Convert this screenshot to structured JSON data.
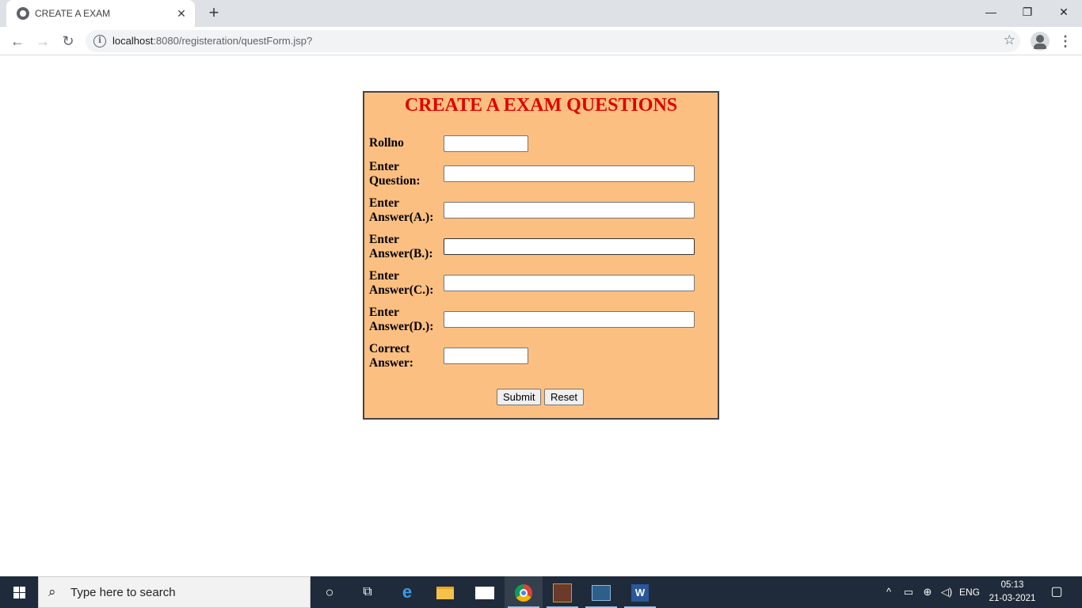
{
  "browser": {
    "tab_title": "CREATE A EXAM",
    "new_tab": "+",
    "url_host": "localhost",
    "url_path": ":8080/registeration/questForm.jsp?",
    "window": {
      "minimize": "—",
      "restore": "❐",
      "close": "✕"
    }
  },
  "form": {
    "title": "CREATE A EXAM QUESTIONS",
    "fields": [
      {
        "label_line1": "Rollno",
        "label_line2": "",
        "value": ""
      },
      {
        "label_line1": "Enter",
        "label_line2": "Question:",
        "value": ""
      },
      {
        "label_line1": "Enter",
        "label_line2": "Answer(A.):",
        "value": ""
      },
      {
        "label_line1": "Enter",
        "label_line2": "Answer(B.):",
        "value": ""
      },
      {
        "label_line1": "Enter",
        "label_line2": "Answer(C.):",
        "value": ""
      },
      {
        "label_line1": "Enter",
        "label_line2": "Answer(D.):",
        "value": ""
      },
      {
        "label_line1": "Correct",
        "label_line2": "Answer:",
        "value": ""
      }
    ],
    "submit_label": "Submit",
    "reset_label": "Reset"
  },
  "taskbar": {
    "search_placeholder": "Type here to search",
    "language": "ENG",
    "time": "05:13",
    "date": "21-03-2021"
  },
  "colors": {
    "form_background": "#fbbf81",
    "title_red": "#e00000",
    "taskbar": "#1f2b3a"
  }
}
